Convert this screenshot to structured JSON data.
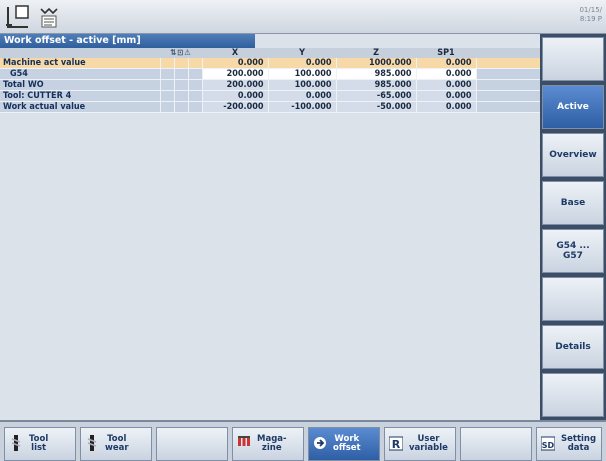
{
  "header": {
    "date": "01/15/",
    "time": "8:19 P"
  },
  "panel": {
    "title": "Work offset - active [mm]",
    "columns": [
      "X",
      "Y",
      "Z",
      "SP1"
    ],
    "rows": [
      {
        "label": "Machine act value",
        "values": [
          "0.000",
          "0.000",
          "1000.000",
          "0.000"
        ],
        "style": "hl"
      },
      {
        "label": "G54",
        "values": [
          "200.000",
          "100.000",
          "985.000",
          "0.000"
        ],
        "style": "white",
        "indent": true
      },
      {
        "label": "Total WO",
        "values": [
          "200.000",
          "100.000",
          "985.000",
          "0.000"
        ],
        "style": ""
      },
      {
        "label": "Tool: CUTTER 4",
        "values": [
          "0.000",
          "0.000",
          "-65.000",
          "0.000"
        ],
        "style": ""
      },
      {
        "label": "Work actual value",
        "values": [
          "-200.000",
          "-100.000",
          "-50.000",
          "0.000"
        ],
        "style": ""
      }
    ]
  },
  "vertical_softkeys": [
    "",
    "Active",
    "Overview",
    "Base",
    "G54 ...\nG57",
    "",
    "Details",
    ""
  ],
  "horizontal_softkeys": [
    {
      "label": "Tool\nlist",
      "icon": "tool-list-icon"
    },
    {
      "label": "Tool\nwear",
      "icon": "tool-wear-icon"
    },
    {
      "label": "",
      "icon": ""
    },
    {
      "label": "Maga-\nzine",
      "icon": "magazine-icon"
    },
    {
      "label": "Work\noffset",
      "icon": "work-offset-icon",
      "active": true
    },
    {
      "label": "User\nvariable",
      "icon": "user-variable-icon"
    },
    {
      "label": "",
      "icon": ""
    },
    {
      "label": "Setting\ndata",
      "icon": "setting-data-icon"
    }
  ],
  "colors": {
    "title_bar": "#2f5f9d",
    "active_key": "#2e5fa6",
    "highlight_row": "#f7d9a8"
  }
}
